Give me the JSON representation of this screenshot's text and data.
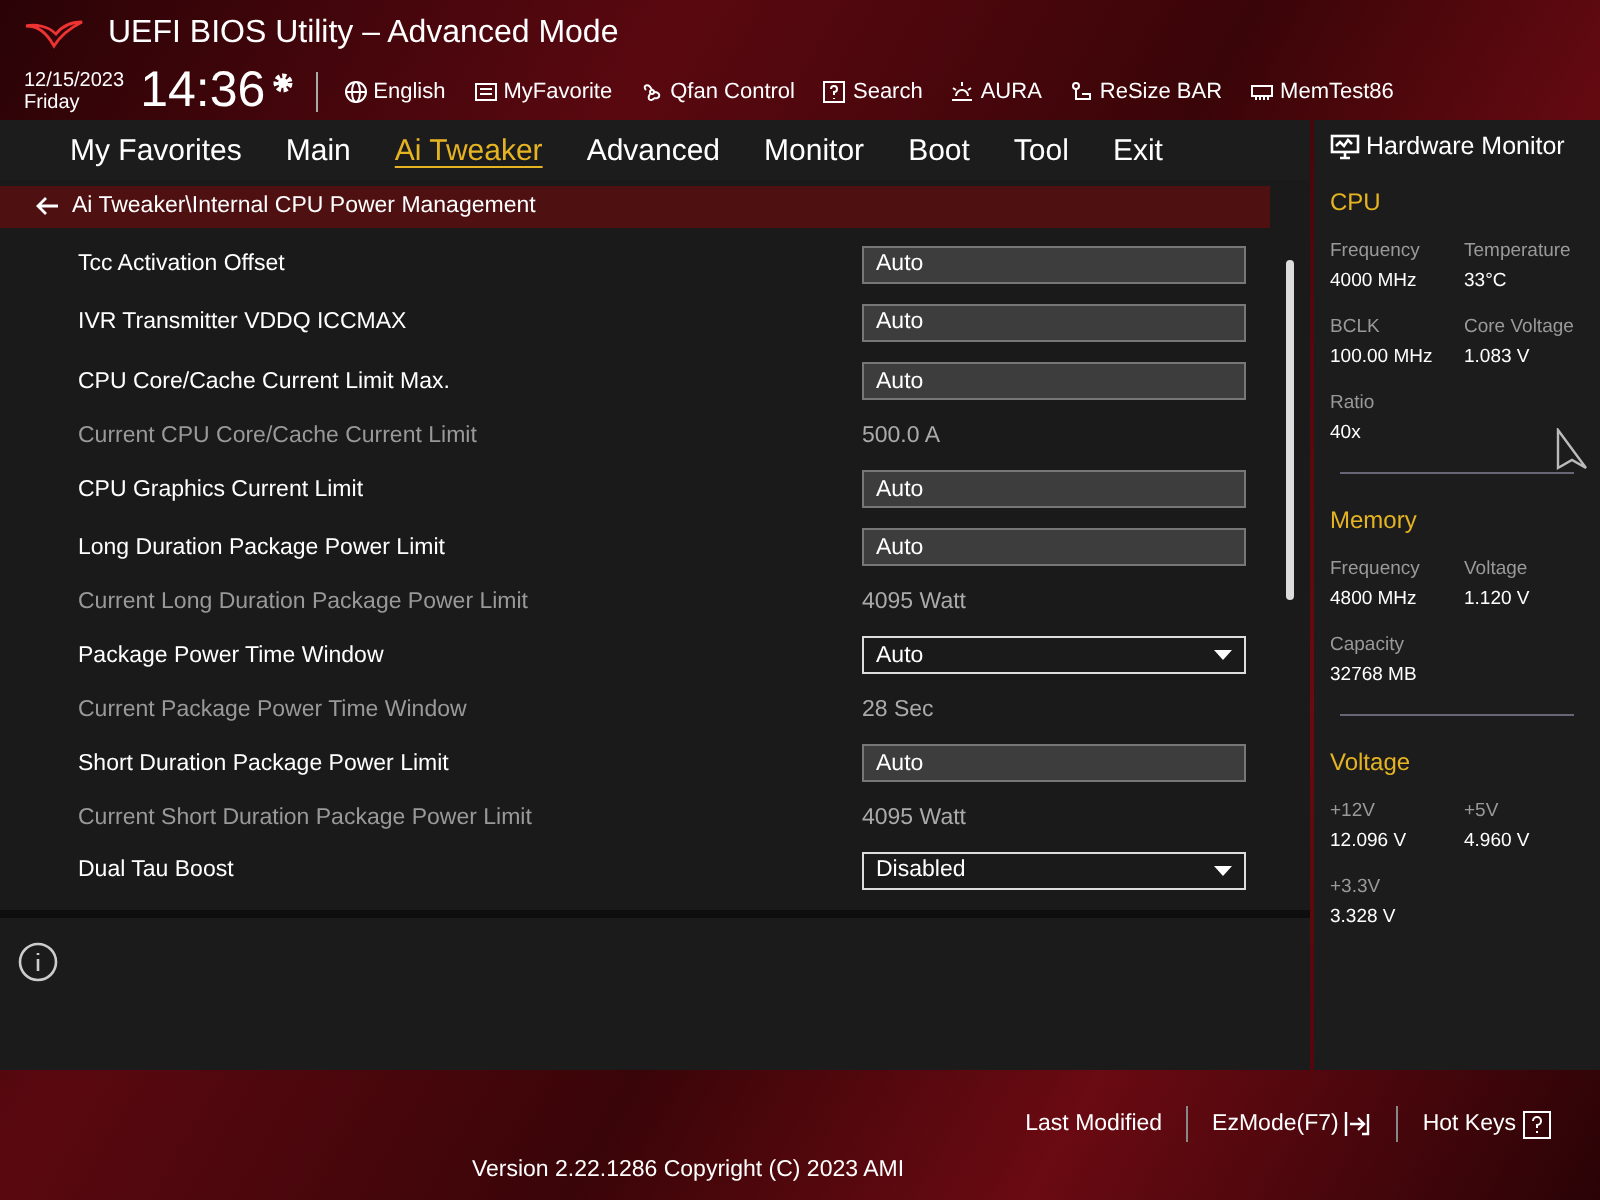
{
  "window": {
    "title": "UEFI BIOS Utility – Advanced Mode"
  },
  "clock": {
    "date": "12/15/2023",
    "weekday": "Friday",
    "time": "14:36"
  },
  "toolbar": [
    {
      "kind": "globe",
      "label": "English"
    },
    {
      "kind": "favorite",
      "label": "MyFavorite"
    },
    {
      "kind": "fan",
      "label": "Qfan Control"
    },
    {
      "kind": "search",
      "label": "Search"
    },
    {
      "kind": "aura",
      "label": "AURA"
    },
    {
      "kind": "resize",
      "label": "ReSize BAR"
    },
    {
      "kind": "memtest",
      "label": "MemTest86"
    }
  ],
  "tabs": [
    {
      "label": "My Favorites",
      "selected": false
    },
    {
      "label": "Main",
      "selected": false
    },
    {
      "label": "Ai Tweaker",
      "selected": true
    },
    {
      "label": "Advanced",
      "selected": false
    },
    {
      "label": "Monitor",
      "selected": false
    },
    {
      "label": "Boot",
      "selected": false
    },
    {
      "label": "Tool",
      "selected": false
    },
    {
      "label": "Exit",
      "selected": false
    }
  ],
  "breadcrumb": "Ai Tweaker\\Internal CPU Power Management",
  "settings": [
    {
      "kind": "field",
      "label": "Tcc Activation Offset",
      "value": "Auto"
    },
    {
      "kind": "field",
      "label": "IVR Transmitter VDDQ ICCMAX",
      "value": "Auto"
    },
    {
      "kind": "field",
      "label": "CPU Core/Cache Current Limit Max.",
      "value": "Auto"
    },
    {
      "kind": "readonly",
      "label": "Current CPU Core/Cache Current Limit",
      "value": "500.0 A"
    },
    {
      "kind": "field",
      "label": "CPU Graphics Current Limit",
      "value": "Auto"
    },
    {
      "kind": "field",
      "label": "Long Duration Package Power Limit",
      "value": "Auto"
    },
    {
      "kind": "readonly",
      "label": "Current Long Duration Package Power Limit",
      "value": "4095 Watt"
    },
    {
      "kind": "dropdown",
      "label": "Package Power Time Window",
      "value": "Auto"
    },
    {
      "kind": "readonly",
      "label": "Current Package Power Time Window",
      "value": "28 Sec"
    },
    {
      "kind": "field",
      "label": "Short Duration Package Power Limit",
      "value": "Auto"
    },
    {
      "kind": "readonly",
      "label": "Current Short Duration Package Power Limit",
      "value": "4095 Watt"
    },
    {
      "kind": "dropdown",
      "label": "Dual Tau Boost",
      "value": "Disabled"
    }
  ],
  "hardware_monitor": {
    "title": "Hardware Monitor",
    "sections": [
      {
        "title": "CPU",
        "items": [
          {
            "label": "Frequency",
            "value": "4000 MHz"
          },
          {
            "label": "Temperature",
            "value": "33°C"
          },
          {
            "label": "BCLK",
            "value": "100.00 MHz"
          },
          {
            "label": "Core Voltage",
            "value": "1.083 V"
          },
          {
            "label": "Ratio",
            "value": "40x"
          }
        ]
      },
      {
        "title": "Memory",
        "items": [
          {
            "label": "Frequency",
            "value": "4800 MHz"
          },
          {
            "label": "Voltage",
            "value": "1.120 V"
          },
          {
            "label": "Capacity",
            "value": "32768 MB"
          }
        ]
      },
      {
        "title": "Voltage",
        "items": [
          {
            "label": "+12V",
            "value": "12.096 V"
          },
          {
            "label": "+5V",
            "value": "4.960 V"
          },
          {
            "label": "+3.3V",
            "value": "3.328 V"
          }
        ]
      }
    ]
  },
  "footer": {
    "actions": [
      {
        "kind": "text",
        "label": "Last Modified"
      },
      {
        "kind": "ezmode",
        "label": "EzMode(F7)"
      },
      {
        "kind": "hotkeys",
        "label": "Hot Keys"
      }
    ],
    "version": "Version 2.22.1286 Copyright (C) 2023 AMI"
  }
}
